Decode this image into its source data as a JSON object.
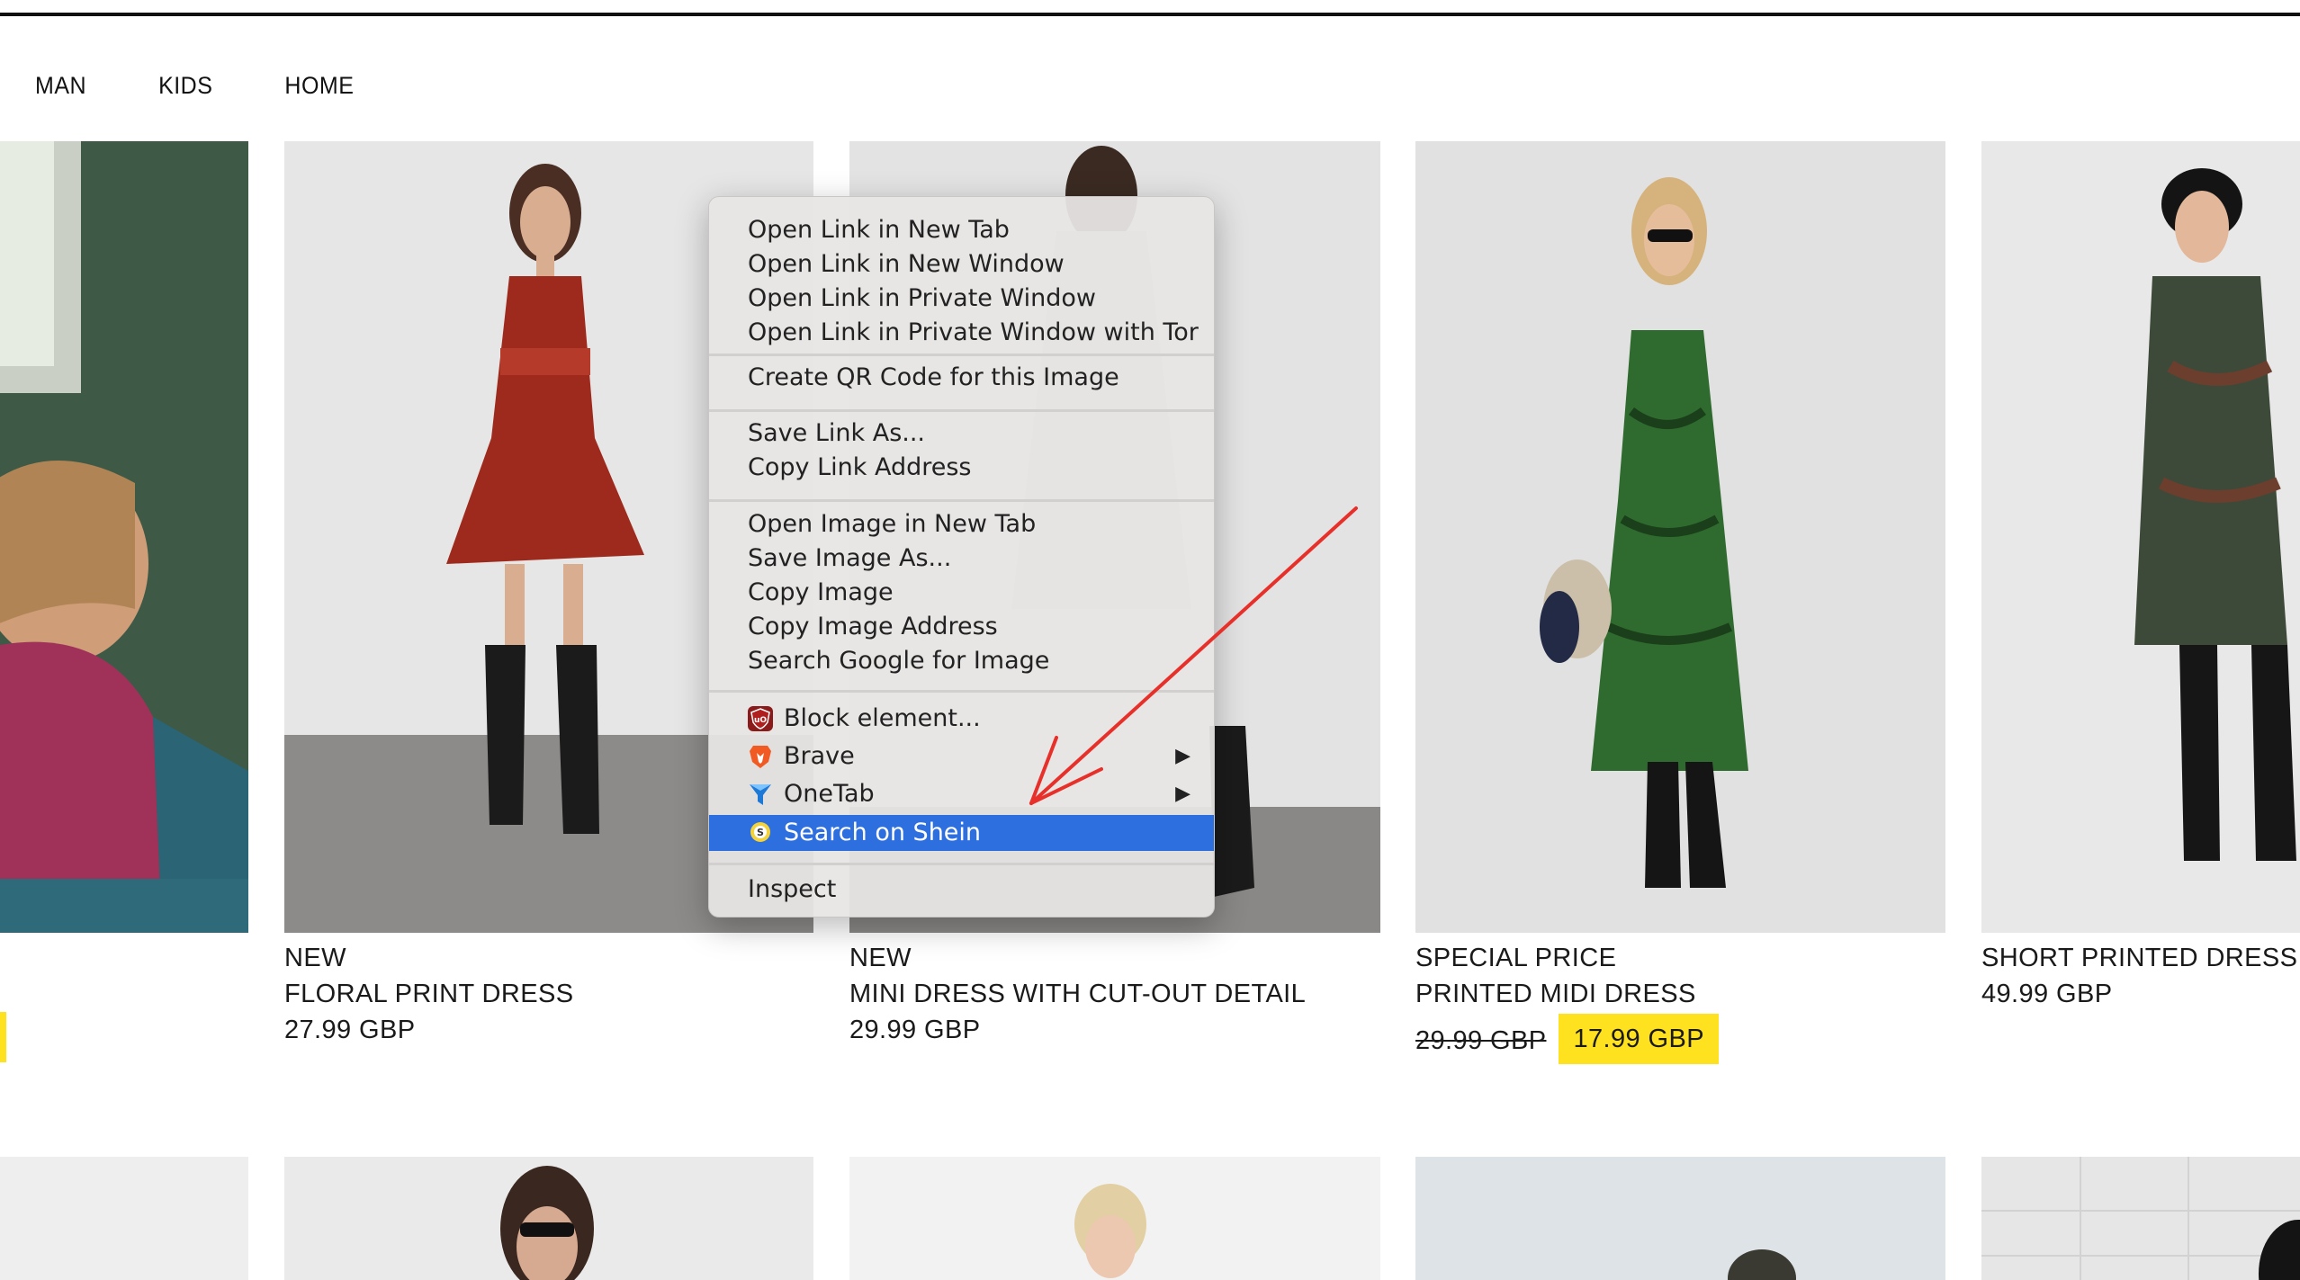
{
  "nav": {
    "items": [
      "MAN",
      "KIDS",
      "HOME"
    ]
  },
  "products": [
    {
      "badge": "NEW",
      "name": "FLORAL PRINT DRESS",
      "price": "27.99 GBP"
    },
    {
      "badge": "NEW",
      "name": "MINI DRESS WITH CUT-OUT DETAIL",
      "price": "29.99 GBP"
    },
    {
      "badge": "SPECIAL PRICE",
      "name": "PRINTED MIDI DRESS",
      "old_price": "29.99 GBP",
      "sale_price": "17.99 GBP"
    },
    {
      "name": "SHORT PRINTED DRESS",
      "price": "49.99 GBP"
    }
  ],
  "context_menu": {
    "open_link_new_tab": "Open Link in New Tab",
    "open_link_new_window": "Open Link in New Window",
    "open_link_private": "Open Link in Private Window",
    "open_link_private_tor": "Open Link in Private Window with Tor",
    "create_qr": "Create QR Code for this Image",
    "save_link_as": "Save Link As...",
    "copy_link_address": "Copy Link Address",
    "open_image_new_tab": "Open Image in New Tab",
    "save_image_as": "Save Image As...",
    "copy_image": "Copy Image",
    "copy_image_address": "Copy Image Address",
    "search_google_image": "Search Google for Image",
    "block_element": "Block element...",
    "brave": "Brave",
    "onetab": "OneTab",
    "search_shein": "Search on Shein",
    "inspect": "Inspect"
  },
  "icons": {
    "ublock": "ublock-origin-icon",
    "brave": "brave-lion-icon",
    "onetab": "onetab-funnel-icon",
    "shein": "shein-search-icon",
    "submenu": "submenu-arrow-icon"
  },
  "colors": {
    "highlight": "#2e6fe0",
    "sale": "#ffe21f",
    "annotation_arrow": "#e8302a"
  }
}
